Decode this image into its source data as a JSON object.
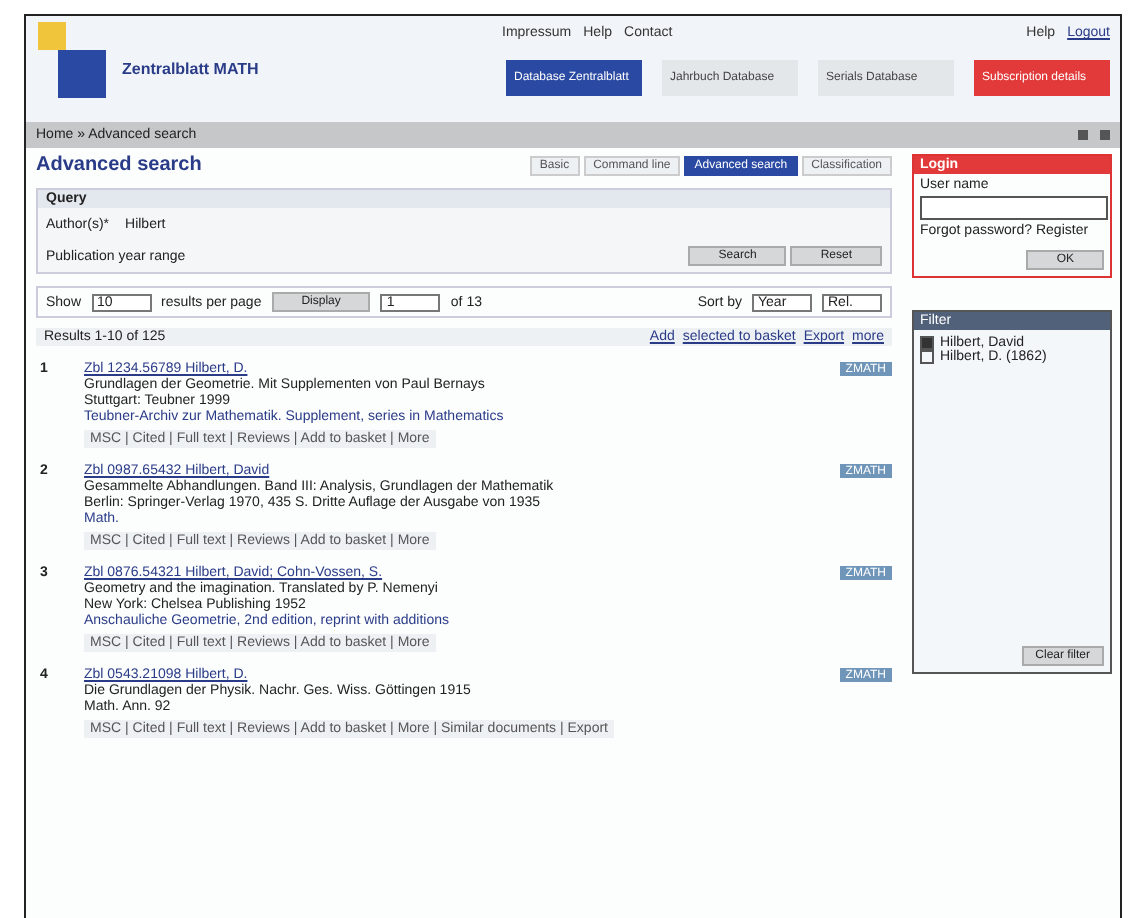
{
  "header": {
    "title": "Zentralblatt MATH",
    "top_links": [
      "Impressum",
      "Help",
      "Contact"
    ],
    "user_links": [
      "Help",
      "Logout"
    ],
    "nav": [
      {
        "label": "Database Zentralblatt",
        "kind": "primary"
      },
      {
        "label": "Jahrbuch Database",
        "kind": "plain"
      },
      {
        "label": "Serials Database",
        "kind": "plain"
      },
      {
        "label": "Subscription details",
        "kind": "alert"
      }
    ]
  },
  "breadcrumb": "Home » Advanced search",
  "page_title": "Advanced search",
  "tabs": [
    {
      "label": "Basic",
      "selected": false
    },
    {
      "label": "Command line",
      "selected": false
    },
    {
      "label": "Advanced search",
      "selected": true
    },
    {
      "label": "Classification",
      "selected": false
    }
  ],
  "query": {
    "heading": "Query",
    "fields": [
      {
        "label": "Author(s)*",
        "value": "Hilbert"
      },
      {
        "label": "Publication year range"
      }
    ],
    "buttons": [
      "Search",
      "Reset"
    ]
  },
  "paging": {
    "show_label": "Show",
    "per_page": "10",
    "per_page_label": "results per page",
    "display_button": "Display",
    "page": "1",
    "page_label": "of 13",
    "sort_label": "Sort by",
    "sort": [
      "Year",
      "Rel."
    ]
  },
  "results_header": {
    "count": "Results 1-10 of 125",
    "actions": [
      "Add",
      "selected to basket",
      "Export",
      "more"
    ]
  },
  "results": [
    {
      "number": "1",
      "title": "Zbl 1234.56789 Hilbert, D.",
      "authors": "Grundlagen der Geometrie. Mit Supplementen von Paul Bernays",
      "source": "Stuttgart: Teubner 1999",
      "extra": "Teubner-Archiv zur Mathematik. Supplement, series in Mathematics",
      "links": "MSC | Cited | Full text | Reviews | Add to basket | More",
      "badge": "ZMATH"
    },
    {
      "number": "2",
      "title": "Zbl 0987.65432 Hilbert, David",
      "authors": "Gesammelte Abhandlungen. Band III: Analysis, Grundlagen der Mathematik",
      "source": "Berlin: Springer-Verlag 1970, 435 S. Dritte Auflage der Ausgabe von 1935",
      "extra": "Math.",
      "links": "MSC | Cited | Full text | Reviews | Add to basket | More",
      "badge": "ZMATH"
    },
    {
      "number": "3",
      "title": "Zbl 0876.54321 Hilbert, David; Cohn-Vossen, S.",
      "authors": "Geometry and the imagination. Translated by P. Nemenyi",
      "source": "New York: Chelsea Publishing 1952",
      "extra": "Anschauliche Geometrie, 2nd edition, reprint with additions",
      "links": "MSC | Cited | Full text | Reviews | Add to basket | More",
      "badge": "ZMATH"
    },
    {
      "number": "4",
      "title": "Zbl 0543.21098 Hilbert, D.",
      "authors": "Die Grundlagen der Physik. Nachr. Ges. Wiss. Göttingen 1915",
      "source": "Math. Ann. 92",
      "links": "MSC | Cited | Full text | Reviews | Add to basket | More | Similar documents | Export",
      "badge": "ZMATH"
    }
  ],
  "login": {
    "heading": "Login",
    "user_label": "User name",
    "note": "Forgot password? Register",
    "button": "OK"
  },
  "filter": {
    "heading": "Filter",
    "items": [
      {
        "label": "Hilbert, David",
        "checked": true
      },
      {
        "label": "Hilbert, D. (1862)",
        "checked": false
      }
    ],
    "button": "Clear filter"
  }
}
